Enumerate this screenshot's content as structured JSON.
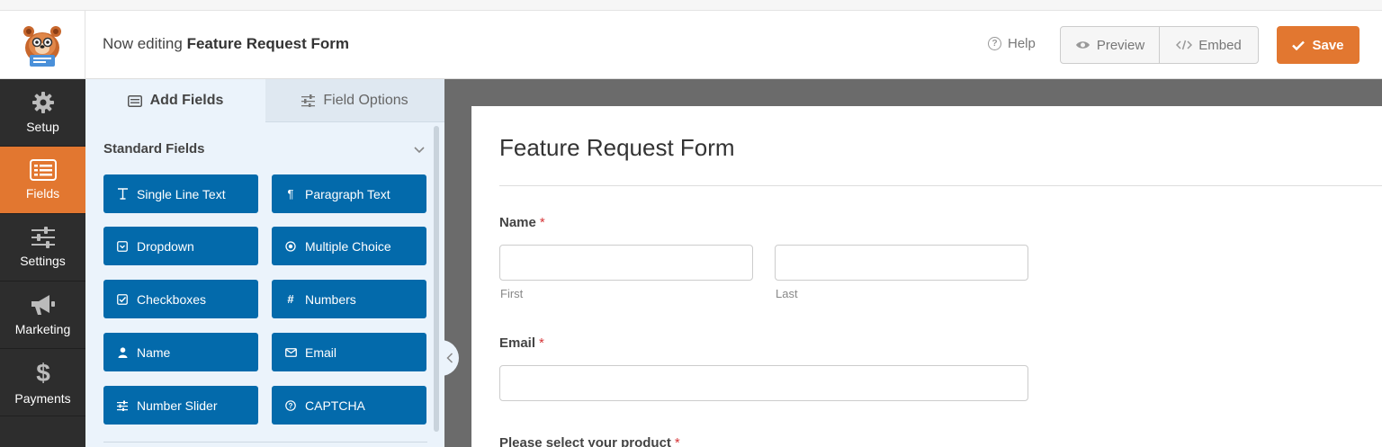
{
  "header": {
    "editing_prefix": "Now editing",
    "form_name": "Feature Request Form",
    "help_label": "Help",
    "preview_label": "Preview",
    "embed_label": "Embed",
    "save_label": "Save"
  },
  "leftnav": {
    "items": [
      {
        "label": "Setup",
        "icon": "gear-icon"
      },
      {
        "label": "Fields",
        "icon": "fields-list-icon",
        "active": true
      },
      {
        "label": "Settings",
        "icon": "sliders-icon"
      },
      {
        "label": "Marketing",
        "icon": "megaphone-icon"
      },
      {
        "label": "Payments",
        "icon": "dollar-icon"
      }
    ]
  },
  "panel": {
    "tabs": {
      "add_fields": "Add Fields",
      "field_options": "Field Options"
    },
    "section_title": "Standard Fields",
    "fields": [
      {
        "label": "Single Line Text",
        "icon": "text-cursor-icon"
      },
      {
        "label": "Paragraph Text",
        "icon": "paragraph-icon"
      },
      {
        "label": "Dropdown",
        "icon": "dropdown-icon"
      },
      {
        "label": "Multiple Choice",
        "icon": "radio-icon"
      },
      {
        "label": "Checkboxes",
        "icon": "checkbox-icon"
      },
      {
        "label": "Numbers",
        "icon": "hash-icon"
      },
      {
        "label": "Name",
        "icon": "user-icon"
      },
      {
        "label": "Email",
        "icon": "envelope-icon"
      },
      {
        "label": "Number Slider",
        "icon": "slider-icon"
      },
      {
        "label": "CAPTCHA",
        "icon": "question-circle-icon"
      }
    ]
  },
  "form": {
    "title": "Feature Request Form",
    "name_label": "Name",
    "first_sublabel": "First",
    "last_sublabel": "Last",
    "email_label": "Email",
    "product_label": "Please select your product",
    "required_mark": "*"
  },
  "colors": {
    "accent": "#e27730",
    "field_button": "#036aab",
    "nav_bg": "#2d2d2d"
  }
}
